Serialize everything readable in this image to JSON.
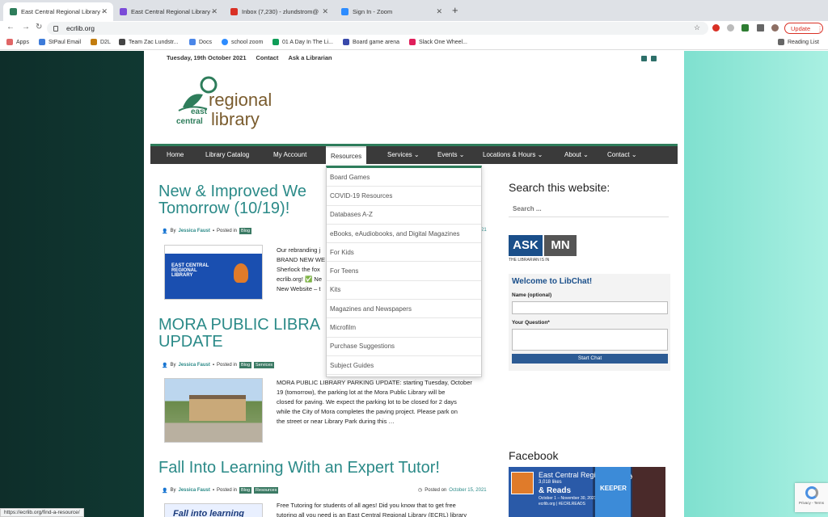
{
  "browser": {
    "tabs": [
      {
        "title": "East Central Regional Library -",
        "color": "#2e7d5b"
      },
      {
        "title": "East Central Regional Library -",
        "color": "#7b4bd8"
      },
      {
        "title": "Inbox (7,230) - zlundstrom@",
        "color": "#d93025"
      },
      {
        "title": "Sign In - Zoom",
        "color": "#2d8cff"
      }
    ],
    "url": "ecrlib.org",
    "update_label": "Update",
    "bookmarks": [
      {
        "label": "Apps",
        "color": "#e06666"
      },
      {
        "label": "StPaul Email",
        "color": "#3d7bd9"
      },
      {
        "label": "D2L",
        "color": "#c27c0e"
      },
      {
        "label": "Team Zac Lundstr...",
        "color": "#444444"
      },
      {
        "label": "Docs",
        "color": "#4a86e8"
      },
      {
        "label": "school zoom",
        "color": "#2d8cff"
      },
      {
        "label": "01 A Day In The Li...",
        "color": "#0f9d58"
      },
      {
        "label": "Board game arena",
        "color": "#3949ab"
      },
      {
        "label": "Slack One Wheel...",
        "color": "#e01e5a"
      }
    ],
    "reading_list": "Reading List",
    "status_url": "https://ecrlib.org/find-a-resource/"
  },
  "site": {
    "date": "Tuesday, 19th October 2021",
    "top_links": [
      "Contact",
      "Ask a Librarian"
    ],
    "logo": {
      "line1": "regional",
      "line2": "east",
      "line3": "central",
      "line4": "library"
    },
    "nav": [
      "Home",
      "Library Catalog",
      "My Account",
      "Resources",
      "Services",
      "Events",
      "Locations & Hours",
      "About",
      "Contact"
    ],
    "dropdown": [
      "Board Games",
      "COVID-19 Resources",
      "Databases A-Z",
      "eBooks, eAudiobooks, and Digital Magazines",
      "For Kids",
      "For Teens",
      "Kits",
      "Magazines and Newspapers",
      "Microfilm",
      "Purchase Suggestions",
      "Subject Guides"
    ],
    "posts": [
      {
        "title_l1": "New & Improved We",
        "title_l2": "Tomorrow (10/19)!",
        "by": "By",
        "author": "Jessica Faust",
        "posted_in": "Posted in",
        "tags": [
          "Blog"
        ],
        "date_suffix": "21",
        "excerpt": [
          "Our rebranding j",
          "BRAND NEW WE",
          "Sherlock the fox",
          "ecrlib.org!  ✅ Ne",
          "New Website – t"
        ]
      },
      {
        "title_l1": "MORA PUBLIC LIBRA",
        "title_l2": "UPDATE",
        "by": "By",
        "author": "Jessica Faust",
        "posted_in": "Posted in",
        "tags": [
          "Blog",
          "Services"
        ],
        "date_suffix": "21",
        "excerpt": [
          "MORA PUBLIC LIBRARY PARKING UPDATE: starting Tuesday, October",
          "19 (tomorrow), the parking lot at the Mora Public Library will be",
          "closed for paving. We expect the parking lot to be closed for 2 days",
          "while the City of Mora completes the paving project.   Please park on",
          "the street or near Library Park during this …"
        ]
      },
      {
        "title_l1": "Fall Into Learning With an Expert Tutor!",
        "by": "By",
        "author": "Jessica Faust",
        "posted_in": "Posted in",
        "tags": [
          "Blog",
          "Resources"
        ],
        "posted_on": "Posted on",
        "date": "October 15, 2021",
        "excerpt": [
          "Free Tutoring for students of all ages! Did you know that to get free",
          "tutoring all you need is an East Central Regional Library (ECRL) library"
        ]
      }
    ],
    "thumb1": {
      "heading": "EAST CENTRAL REGIONAL LIBRARY"
    },
    "thumb3": {
      "text": "Fall into learning"
    },
    "sidebar": {
      "search_heading": "Search this website:",
      "search_placeholder": "Search ...",
      "askmn_ask": "ASK",
      "askmn_mn": "MN",
      "askmn_sub": "THE LIBRARIAN IS IN",
      "libchat_title": "Welcome to LibChat!",
      "name_label": "Name (optional)",
      "question_label": "Your Question*",
      "start_chat": "Start Chat",
      "facebook_heading": "Facebook",
      "fb_page": "East Central Regional Library",
      "fb_likes": "3,018 likes",
      "fb_reads": "& Reads",
      "fb_sub": "October 1 – November 30, 2021",
      "fb_tag": "ecrlib.org | #ECRLREADS",
      "fb_book": "KEEPER"
    },
    "recaptcha_text": "Privacy - Terms"
  }
}
